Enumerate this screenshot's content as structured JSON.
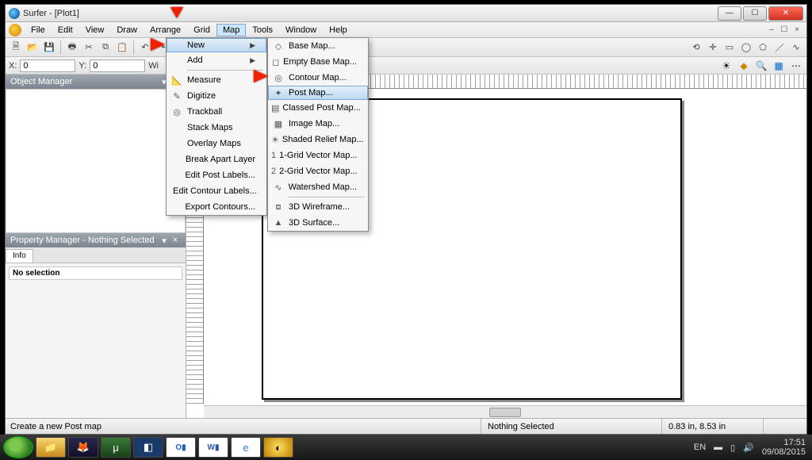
{
  "titlebar": {
    "title": "Surfer - [Plot1]"
  },
  "menubar": {
    "items": [
      "File",
      "Edit",
      "View",
      "Draw",
      "Arrange",
      "Grid",
      "Map",
      "Tools",
      "Window",
      "Help"
    ],
    "open_index": 6,
    "doc_buttons": "– ☐ ×"
  },
  "coords": {
    "x_label": "X:",
    "x_value": "0",
    "y_label": "Y:",
    "y_value": "0",
    "wi_label": "Wi"
  },
  "map_menu": {
    "items": [
      {
        "label": "New",
        "submenu": true,
        "hover": true
      },
      {
        "label": "Add",
        "submenu": true
      },
      {
        "sep": true
      },
      {
        "label": "Measure",
        "icon": "📐"
      },
      {
        "label": "Digitize",
        "icon": "✎"
      },
      {
        "label": "Trackball",
        "icon": "◎"
      },
      {
        "label": "Stack Maps"
      },
      {
        "label": "Overlay Maps"
      },
      {
        "label": "Break Apart Layer"
      },
      {
        "label": "Edit Post Labels..."
      },
      {
        "label": "Edit Contour Labels..."
      },
      {
        "label": "Export Contours..."
      }
    ]
  },
  "new_menu": {
    "items": [
      {
        "label": "Base Map...",
        "icon": "◇"
      },
      {
        "label": "Empty Base Map...",
        "icon": "◻"
      },
      {
        "label": "Contour Map...",
        "icon": "◎"
      },
      {
        "label": "Post Map...",
        "icon": "✦",
        "hover": true
      },
      {
        "label": "Classed Post Map...",
        "icon": "▤"
      },
      {
        "label": "Image Map...",
        "icon": "▦"
      },
      {
        "label": "Shaded Relief Map...",
        "icon": "☀"
      },
      {
        "label": "1-Grid Vector Map...",
        "icon": "1"
      },
      {
        "label": "2-Grid Vector Map...",
        "icon": "2"
      },
      {
        "label": "Watershed Map...",
        "icon": "∿"
      },
      {
        "sep": true
      },
      {
        "label": "3D Wireframe...",
        "icon": "⧈"
      },
      {
        "label": "3D Surface...",
        "icon": "▲"
      }
    ]
  },
  "panels": {
    "object_manager": "Object Manager",
    "property_manager": "Property Manager - Nothing Selected",
    "info_tab": "Info",
    "no_selection": "No selection"
  },
  "status": {
    "hint": "Create a new Post map",
    "selection": "Nothing Selected",
    "position": "0.83 in, 8.53 in"
  },
  "tray": {
    "lang": "EN",
    "flag": "▬",
    "net": "▯",
    "vol": "🔊",
    "time": "17:51",
    "date": "09/08/2015"
  }
}
